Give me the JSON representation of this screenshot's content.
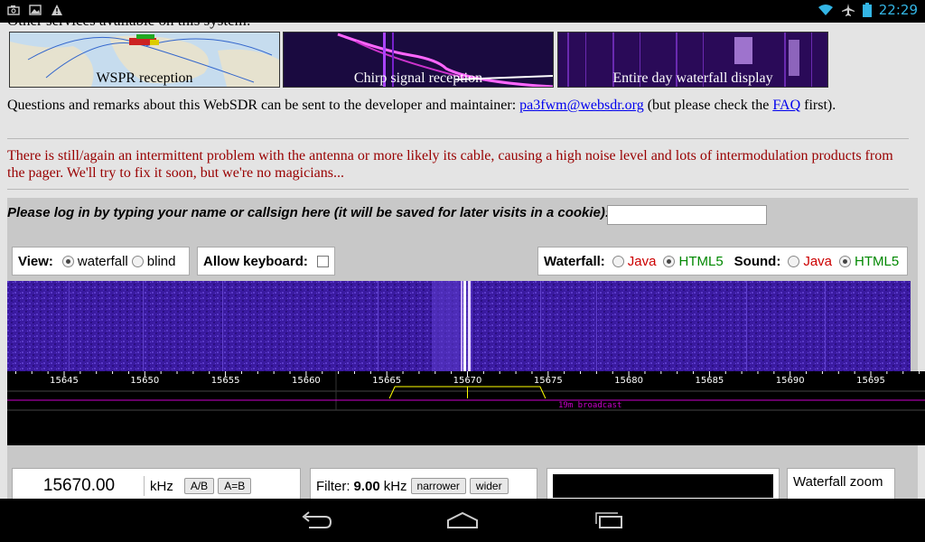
{
  "status_bar": {
    "time": "22:29"
  },
  "intro_cut": "Other services available on this system:",
  "thumbnails": [
    {
      "caption": "WSPR reception"
    },
    {
      "caption": "Chirp signal reception"
    },
    {
      "caption": "Entire day waterfall display"
    }
  ],
  "contact": {
    "text_before": "Questions and remarks about this WebSDR can be sent to the developer and maintainer: ",
    "email": "pa3fwm@websdr.org",
    "text_middle": " (but please check the ",
    "faq": "FAQ",
    "text_after": " first)."
  },
  "warning": "There is still/again an intermittent problem with the antenna or more likely its cable, causing a high noise level and lots of intermodulation products from the pager. We'll try to fix it soon, but we're no magicians...",
  "login": {
    "prompt": "Please log in by typing your name or callsign here (it will be saved for later visits in a cookie):",
    "value": ""
  },
  "view": {
    "label": "View:",
    "options": [
      "waterfall",
      "blind"
    ],
    "selected": "waterfall"
  },
  "keyboard": {
    "label": "Allow keyboard:",
    "checked": false
  },
  "waterfall_opt": {
    "label": "Waterfall:",
    "java": "Java",
    "html5": "HTML5",
    "selected": "HTML5"
  },
  "sound_opt": {
    "label": "Sound:",
    "java": "Java",
    "html5": "HTML5",
    "selected": "HTML5"
  },
  "scale": {
    "ticks": [
      "15645",
      "15650",
      "15655",
      "15660",
      "15665",
      "15670",
      "15675",
      "15680",
      "15685",
      "15690",
      "15695"
    ],
    "band_label": "19m broadcast",
    "colors": {
      "passband": "#ffff00",
      "band": "#cc00cc"
    }
  },
  "frequency": {
    "value": "15670.00",
    "unit": "kHz",
    "btn_ab": "A/B",
    "btn_aeqb": "A=B"
  },
  "filter": {
    "label": "Filter:",
    "value": "9.00",
    "unit": "kHz",
    "narrower": "narrower",
    "wider": "wider"
  },
  "zoom": {
    "label": "Waterfall zoom"
  }
}
